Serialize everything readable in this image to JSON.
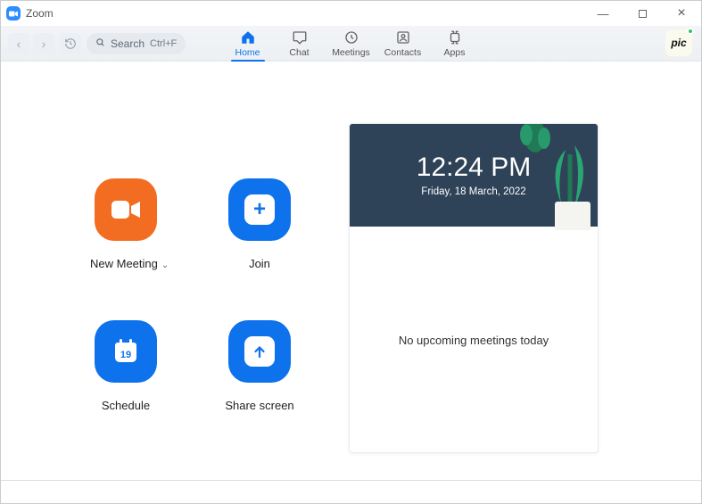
{
  "window": {
    "title": "Zoom"
  },
  "toolbar": {
    "search": {
      "label": "Search",
      "shortcut": "Ctrl+F"
    },
    "tabs": [
      {
        "id": "home",
        "label": "Home",
        "active": true
      },
      {
        "id": "chat",
        "label": "Chat",
        "active": false
      },
      {
        "id": "meetings",
        "label": "Meetings",
        "active": false
      },
      {
        "id": "contacts",
        "label": "Contacts",
        "active": false
      },
      {
        "id": "apps",
        "label": "Apps",
        "active": false
      }
    ],
    "avatar_text": "pic"
  },
  "actions": {
    "new_meeting": "New Meeting",
    "join": "Join",
    "schedule": "Schedule",
    "share_screen": "Share screen",
    "schedule_day": "19"
  },
  "panel": {
    "time": "12:24 PM",
    "date": "Friday, 18 March, 2022",
    "empty_text": "No upcoming meetings today"
  },
  "colors": {
    "accent_blue": "#0e72ed",
    "accent_orange": "#f26d21",
    "highlight_red": "#d93025"
  }
}
